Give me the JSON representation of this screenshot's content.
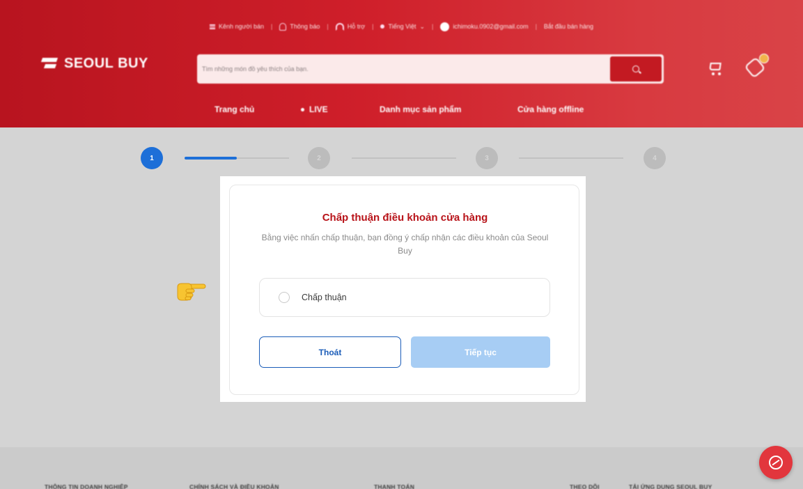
{
  "header": {
    "topbar": {
      "seller_channel": "Kênh người bán",
      "notifications": "Thông báo",
      "support": "Hỗ trợ",
      "language": "Tiếng Việt",
      "email": "ichimoku.0902@gmail.com",
      "start_selling": "Bắt đầu bán hàng"
    },
    "logo_text": "SEOUL BUY",
    "search_placeholder": "Tìm những món đồ yêu thích của bạn.",
    "nav": {
      "home": "Trang chủ",
      "live": "LIVE",
      "categories": "Danh mục sản phẩm",
      "offline_stores": "Cửa hàng offline"
    }
  },
  "stepper": {
    "steps": [
      "1",
      "2",
      "3",
      "4"
    ],
    "active_step": 1
  },
  "modal": {
    "title": "Chấp thuận điều khoản cửa hàng",
    "description": "Bằng việc nhấn chấp thuận, bạn đồng ý chấp nhận các điều khoản của Seoul Buy",
    "option_label": "Chấp thuận",
    "exit_label": "Thoát",
    "next_label": "Tiếp tục"
  },
  "footer": {
    "columns": [
      "THÔNG TIN DOANH NGHIỆP",
      "CHÍNH SÁCH VÀ ĐIỀU KHOẢN",
      "THANH TOÁN",
      "THEO DÕI",
      "TẢI ỨNG DỤNG SEOUL BUY"
    ]
  },
  "colors": {
    "brand_red": "#c31a22",
    "title_red": "#b81319",
    "primary_blue": "#1d6fd8",
    "disabled_blue": "#a7cdf4"
  },
  "icons": [
    "list-icon",
    "bell-icon",
    "headset-icon",
    "globe-icon",
    "info-icon",
    "search-icon",
    "cart-icon",
    "coupon-icon",
    "pointing-hand-icon",
    "chat-icon"
  ]
}
